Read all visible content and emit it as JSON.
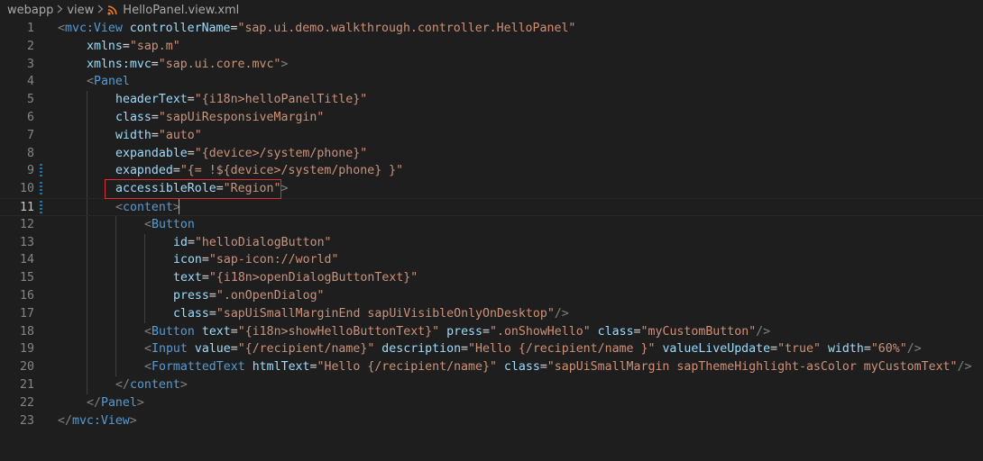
{
  "breadcrumb": {
    "items": [
      "webapp",
      "view",
      "HelloPanel.view.xml"
    ],
    "file_icon": "rss-xml-icon"
  },
  "colors": {
    "background": "#1e1e1e",
    "tag": "#569cd6",
    "attribute": "#9cdcfe",
    "string": "#ce9178",
    "bracket": "#808080",
    "line_number": "#858585",
    "highlight_box": "#d8312f"
  },
  "editor": {
    "current_line": 11,
    "highlighted_line": 10,
    "modified_lines": [
      9,
      10,
      11
    ],
    "lines": [
      {
        "n": "1",
        "indent": 0,
        "tokens": [
          [
            "b",
            "<"
          ],
          [
            "t",
            "mvc:View"
          ],
          [
            "w",
            " "
          ],
          [
            "a",
            "controllerName"
          ],
          [
            "e",
            "="
          ],
          [
            "s",
            "\"sap.ui.demo.walkthrough.controller.HelloPanel\""
          ]
        ]
      },
      {
        "n": "2",
        "indent": 1,
        "tokens": [
          [
            "a",
            "xmlns"
          ],
          [
            "e",
            "="
          ],
          [
            "s",
            "\"sap.m\""
          ]
        ]
      },
      {
        "n": "3",
        "indent": 1,
        "tokens": [
          [
            "a",
            "xmlns:mvc"
          ],
          [
            "e",
            "="
          ],
          [
            "s",
            "\"sap.ui.core.mvc\""
          ],
          [
            "b",
            ">"
          ]
        ]
      },
      {
        "n": "4",
        "indent": 1,
        "tokens": [
          [
            "b",
            "<"
          ],
          [
            "t",
            "Panel"
          ]
        ]
      },
      {
        "n": "5",
        "indent": 2,
        "tokens": [
          [
            "a",
            "headerText"
          ],
          [
            "e",
            "="
          ],
          [
            "s",
            "\"{i18n>helloPanelTitle}\""
          ]
        ]
      },
      {
        "n": "6",
        "indent": 2,
        "tokens": [
          [
            "a",
            "class"
          ],
          [
            "e",
            "="
          ],
          [
            "s",
            "\"sapUiResponsiveMargin\""
          ]
        ]
      },
      {
        "n": "7",
        "indent": 2,
        "tokens": [
          [
            "a",
            "width"
          ],
          [
            "e",
            "="
          ],
          [
            "s",
            "\"auto\""
          ]
        ]
      },
      {
        "n": "8",
        "indent": 2,
        "tokens": [
          [
            "a",
            "expandable"
          ],
          [
            "e",
            "="
          ],
          [
            "s",
            "\"{device>/system/phone}\""
          ]
        ]
      },
      {
        "n": "9",
        "indent": 2,
        "tokens": [
          [
            "a",
            "exapnded"
          ],
          [
            "e",
            "="
          ],
          [
            "s",
            "\"{= !${device>/system/phone} }\""
          ]
        ]
      },
      {
        "n": "10",
        "indent": 2,
        "tokens": [
          [
            "a",
            "accessibleRole"
          ],
          [
            "e",
            "="
          ],
          [
            "s",
            "\"Region\""
          ],
          [
            "b",
            ">"
          ]
        ]
      },
      {
        "n": "11",
        "indent": 2,
        "tokens": [
          [
            "b",
            "<"
          ],
          [
            "t",
            "content"
          ],
          [
            "b",
            ">"
          ]
        ]
      },
      {
        "n": "12",
        "indent": 3,
        "tokens": [
          [
            "b",
            "<"
          ],
          [
            "t",
            "Button"
          ]
        ]
      },
      {
        "n": "13",
        "indent": 4,
        "tokens": [
          [
            "a",
            "id"
          ],
          [
            "e",
            "="
          ],
          [
            "s",
            "\"helloDialogButton\""
          ]
        ]
      },
      {
        "n": "14",
        "indent": 4,
        "tokens": [
          [
            "a",
            "icon"
          ],
          [
            "e",
            "="
          ],
          [
            "s",
            "\"sap-icon://world\""
          ]
        ]
      },
      {
        "n": "15",
        "indent": 4,
        "tokens": [
          [
            "a",
            "text"
          ],
          [
            "e",
            "="
          ],
          [
            "s",
            "\"{i18n>openDialogButtonText}\""
          ]
        ]
      },
      {
        "n": "16",
        "indent": 4,
        "tokens": [
          [
            "a",
            "press"
          ],
          [
            "e",
            "="
          ],
          [
            "s",
            "\".onOpenDialog\""
          ]
        ]
      },
      {
        "n": "17",
        "indent": 4,
        "tokens": [
          [
            "a",
            "class"
          ],
          [
            "e",
            "="
          ],
          [
            "s",
            "\"sapUiSmallMarginEnd sapUiVisibleOnlyOnDesktop\""
          ],
          [
            "b",
            "/>"
          ]
        ]
      },
      {
        "n": "18",
        "indent": 3,
        "tokens": [
          [
            "b",
            "<"
          ],
          [
            "t",
            "Button"
          ],
          [
            "w",
            " "
          ],
          [
            "a",
            "text"
          ],
          [
            "e",
            "="
          ],
          [
            "s",
            "\"{i18n>showHelloButtonText}\""
          ],
          [
            "w",
            " "
          ],
          [
            "a",
            "press"
          ],
          [
            "e",
            "="
          ],
          [
            "s",
            "\".onShowHello\""
          ],
          [
            "w",
            " "
          ],
          [
            "a",
            "class"
          ],
          [
            "e",
            "="
          ],
          [
            "s",
            "\"myCustomButton\""
          ],
          [
            "b",
            "/>"
          ]
        ]
      },
      {
        "n": "19",
        "indent": 3,
        "tokens": [
          [
            "b",
            "<"
          ],
          [
            "t",
            "Input"
          ],
          [
            "w",
            " "
          ],
          [
            "a",
            "value"
          ],
          [
            "e",
            "="
          ],
          [
            "s",
            "\"{/recipient/name}\""
          ],
          [
            "w",
            " "
          ],
          [
            "a",
            "description"
          ],
          [
            "e",
            "="
          ],
          [
            "s",
            "\"Hello {/recipient/name }\""
          ],
          [
            "w",
            " "
          ],
          [
            "a",
            "valueLiveUpdate"
          ],
          [
            "e",
            "="
          ],
          [
            "s",
            "\"true\""
          ],
          [
            "w",
            " "
          ],
          [
            "a",
            "width"
          ],
          [
            "e",
            "="
          ],
          [
            "s",
            "\"60%\""
          ],
          [
            "b",
            "/>"
          ]
        ]
      },
      {
        "n": "20",
        "indent": 3,
        "tokens": [
          [
            "b",
            "<"
          ],
          [
            "t",
            "FormattedText"
          ],
          [
            "w",
            " "
          ],
          [
            "a",
            "htmlText"
          ],
          [
            "e",
            "="
          ],
          [
            "s",
            "\"Hello {/recipient/name}\""
          ],
          [
            "w",
            " "
          ],
          [
            "a",
            "class"
          ],
          [
            "e",
            "="
          ],
          [
            "s",
            "\"sapUiSmallMargin sapThemeHighlight-asColor myCustomText\""
          ],
          [
            "b",
            "/>"
          ]
        ]
      },
      {
        "n": "21",
        "indent": 2,
        "tokens": [
          [
            "b",
            "</"
          ],
          [
            "t",
            "content"
          ],
          [
            "b",
            ">"
          ]
        ]
      },
      {
        "n": "22",
        "indent": 1,
        "tokens": [
          [
            "b",
            "</"
          ],
          [
            "t",
            "Panel"
          ],
          [
            "b",
            ">"
          ]
        ]
      },
      {
        "n": "23",
        "indent": 0,
        "tokens": [
          [
            "b",
            "</"
          ],
          [
            "t",
            "mvc:View"
          ],
          [
            "b",
            ">"
          ]
        ]
      }
    ]
  }
}
